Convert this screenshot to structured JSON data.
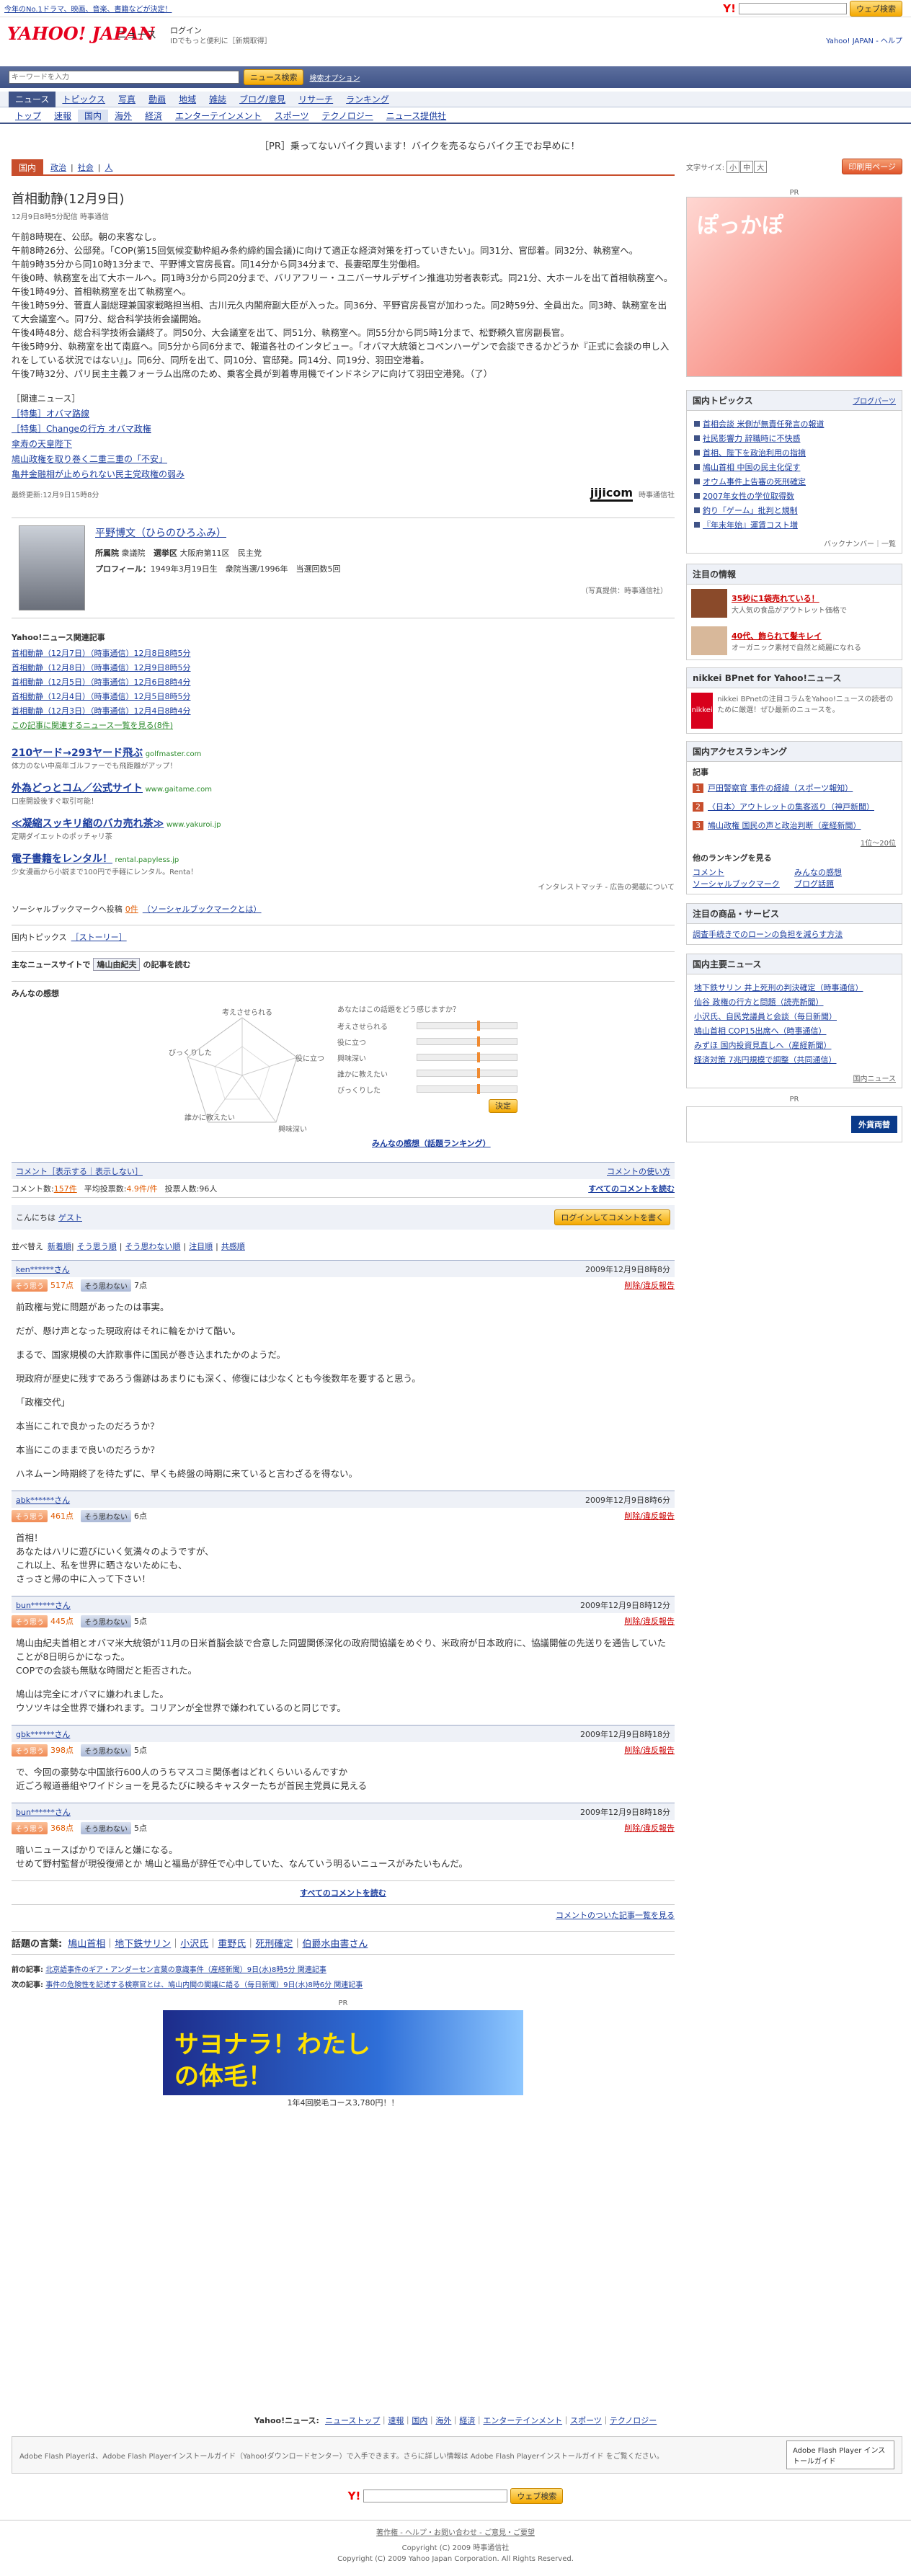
{
  "topbar": {
    "left_text": "今年のNo.1ドラマ、映画、音楽、書籍などが決定！",
    "right_search_button": "ウェブ検索"
  },
  "header": {
    "logo": "YAHOO! JAPAN",
    "section": "ニュース",
    "login": "ログイン",
    "login_note": "IDでもっと便利に［新規取得］",
    "right_links": "Yahoo! JAPAN - ヘルプ"
  },
  "search": {
    "placeholder": "キーワードを入力",
    "button": "ニュース検索",
    "option": "検索オプション"
  },
  "nav1": [
    "ニュース",
    "トピックス",
    "写真",
    "動画",
    "地域",
    "雑誌",
    "ブログ/意見",
    "リサーチ",
    "ランキング"
  ],
  "nav2": [
    "トップ",
    "速報",
    "国内",
    "海外",
    "経済",
    "エンターテインメント",
    "スポーツ",
    "テクノロジー",
    "ニュース提供社"
  ],
  "pr_banner": "［PR］乗ってないバイク買います！バイクを売るならバイク王でお早めに！",
  "tabs": [
    "国内",
    "政治",
    "社会",
    "人"
  ],
  "fontsize_label": "文字サイズ:",
  "fontsize_buttons": [
    "小",
    "中",
    "大"
  ],
  "print_button": "印刷用ページ",
  "article": {
    "title": "首相動静(12月9日)",
    "meta": "12月9日8時5分配信 時事通信",
    "paragraphs": [
      "午前8時現在、公邸。朝の来客なし。",
      "午前8時26分、公邸発。「COP(第15回気候変動枠組み条約締約国会議)に向けて適正な経済対策を打っていきたい」。同31分、官邸着。同32分、執務室へ。",
      "午前9時35分から同10時13分まで、平野博文官房長官。同14分から同34分まで、長妻昭厚生労働相。",
      "午後0時、執務室を出て大ホールへ。同1時3分から同20分まで、バリアフリー・ユニバーサルデザイン推進功労者表彰式。同21分、大ホールを出て首相執務室へ。",
      "午後1時49分、首相執務室を出て執務室へ。",
      "午後1時59分、菅直人副総理兼国家戦略担当相、古川元久内閣府副大臣が入った。同36分、平野官房長官が加わった。同2時59分、全員出た。同3時、執務室を出て大会議室へ。同7分、総合科学技術会議開始。",
      "午後4時48分、総合科学技術会議終了。同50分、大会議室を出て、同51分、執務室へ。同55分から同5時1分まで、松野頼久官房副長官。",
      "午後5時9分、執務室を出て南庭へ。同5分から同6分まで、報道各社のインタビュー。「オバマ大統領とコペンハーゲンで会談できるかどうか『正式に会談の申し入れをしている状況ではない』」。同6分、同所を出て、同10分、官邸発。同14分、同19分、羽田空港着。",
      "午後7時32分、パリ民主主義フォーラム出席のため、乗客全員が到着専用機でインドネシアに向けて羽田空港発。（了）"
    ],
    "related_title": "［関連ニュース］",
    "related": [
      "［特集］オバマ路線",
      "［特集］Changeの行方 オバマ政権",
      "傘寿の天皇陛下",
      "鳩山政権を取り巻く二重三重の「不安」",
      "亀井金融相が止められない民主党政権の弱み"
    ],
    "updated": "最終更新:12月9日15時8分",
    "source_logo": "jijicom",
    "source_name": "時事通信社"
  },
  "profile": {
    "name": "平野博文（ひらのひろふみ）",
    "party_label": "所属院",
    "party": "衆議院",
    "district_label": "選挙区",
    "district": "大阪府第11区",
    "affil": "民主党",
    "profile_label": "プロフィール：",
    "profile_text": "1949年3月19日生　衆院当選/1996年　当選回数5回",
    "photo_credit": "（写真提供：時事通信社）"
  },
  "related_articles": {
    "title": "Yahoo!ニュース関連記事",
    "items": [
      "首相動静（12月7日）（時事通信）12月8日8時5分",
      "首相動静（12月8日）（時事通信）12月9日8時5分",
      "首相動静（12月5日）（時事通信）12月6日8時4分",
      "首相動静（12月4日）（時事通信）12月5日8時5分",
      "首相動静（12月3日）（時事通信）12月4日8時4分"
    ],
    "more": "この記事に関連するニュース一覧を見る(8件)"
  },
  "ads": [
    {
      "title": "210ヤード→293ヤード飛ぶ",
      "url": "golfmaster.com",
      "desc": "体力のない中高年ゴルファーでも飛距離がアップ！"
    },
    {
      "title": "外為どっとコム／公式サイト",
      "url": "www.gaitame.com",
      "desc": "口座開設後すぐ取引可能！"
    },
    {
      "title": "≪凝縮スッキリ縮のバカ売れ茶≫",
      "url": "www.yakuroi.jp",
      "desc": "定期ダイエットのポッチャリ茶"
    },
    {
      "title": "電子書籍をレンタル！",
      "url": "rental.papyless.jp",
      "desc": "少女漫画から小説まで100円で手軽にレンタル。Renta！"
    }
  ],
  "ads_footer": "インタレストマッチ - 広告の掲載について",
  "social": {
    "label": "ソーシャルブックマークへ投稿",
    "count": "0件",
    "link": "（ソーシャルブックマークとは）"
  },
  "topics": {
    "label": "国内トピックス",
    "link": "［ストーリー］"
  },
  "yahoo_main": {
    "label": "主なニュースサイトで",
    "keyword": "鳩山由紀夫",
    "suffix": "の記事を読む"
  },
  "minna": {
    "title": "みんなの感想",
    "question": "あなたはこの話題をどう感じますか？",
    "axes": [
      "考えさせられる",
      "役に立つ",
      "興味深い",
      "誰かに教えたい",
      "びっくりした"
    ],
    "button": "決定",
    "ranking_link": "みんなの感想（話題ランキング）"
  },
  "comments": {
    "header_show": "コメント［表示する｜表示しない］",
    "how_link": "コメントの使い方",
    "count_label": "コメント数:",
    "count": "157件",
    "avg_label": "平均投票数:",
    "avg": "4.9件/件",
    "votes_label": "投票人数:",
    "votes": "96人",
    "read_all": "すべてのコメントを読む",
    "hello": "こんにちは",
    "guest": "ゲスト",
    "login_button": "ログインしてコメントを書く",
    "sort_label": "並べ替え",
    "sort_options": [
      "新着順",
      "そう思う順",
      "そう思わない順",
      "注目順",
      "共感順"
    ],
    "items": [
      {
        "user": "ken******さん",
        "date": "2009年12月9日8時8分",
        "agree": "517点",
        "disagree": "7点",
        "report": "削除/違反報告",
        "body": [
          "前政権与党に問題があったのは事実。",
          "だが、懸け声となった現政府はそれに輪をかけて酷い。",
          "まるで、国家規模の大詐欺事件に国民が巻き込まれたかのようだ。",
          "現政府が歴史に残すであろう傷跡はあまりにも深く、修復には少なくとも今後数年を要すると思う。",
          "「政権交代」",
          "本当にこれで良かったのだろうか？",
          "本当にこのままで良いのだろうか？",
          "ハネムーン時期終了を待たずに、早くも終盤の時期に来ていると言わざるを得ない。"
        ]
      },
      {
        "user": "abk******さん",
        "date": "2009年12月9日8時6分",
        "agree": "461点",
        "disagree": "6点",
        "report": "削除/違反報告",
        "body": [
          "首相！\nあなたはハリに遊びにいく気満々のようですが、\nこれ以上、私を世界に晒さないためにも、\nさっさと帰の中に入って下さい！"
        ]
      },
      {
        "user": "bun******さん",
        "date": "2009年12月9日8時12分",
        "agree": "445点",
        "disagree": "5点",
        "report": "削除/違反報告",
        "body": [
          "鳩山由紀夫首相とオバマ米大統領が11月の日米首脳会談で合意した同盟関係深化の政府間協議をめぐり、米政府が日本政府に、協議開催の先送りを通告していたことが8日明らかになった。\nCOPでの会談も無駄な時間だと拒否された。",
          "鳩山は完全にオバマに嫌われました。\nウソツキは全世界で嫌われます。コリアンが全世界で嫌われているのと同じです。"
        ]
      },
      {
        "user": "gbk******さん",
        "date": "2009年12月9日8時18分",
        "agree": "398点",
        "disagree": "5点",
        "report": "削除/違反報告",
        "body": [
          "で、今回の豪勢な中国旅行600人のうちマスコミ関係者はどれくらいいるんですか\n近ごろ報道番組やワイドショーを見るたびに映るキャスターたちが首民主党員に見える"
        ]
      },
      {
        "user": "bun******さん",
        "date": "2009年12月9日8時18分",
        "agree": "368点",
        "disagree": "5点",
        "report": "削除/違反報告",
        "body": [
          "暗いニュースばかりでほんと嫌になる。\nせめて野村監督が現役復帰とか 鳩山と福島が辞任で心中していた、なんていう明るいニュースがみたいもんだ。"
        ]
      }
    ],
    "read_all_bottom": "すべてのコメントを読む",
    "back_link": "コメントのついた記事一覧を見る"
  },
  "keywords": {
    "label": "話題の言葉:",
    "items": [
      "鳩山首相",
      "地下鉄サリン",
      "小沢氏",
      "重野氏",
      "死刑確定",
      "伯爵水由書さん"
    ]
  },
  "prevnext": {
    "prev_label": "前の記事:",
    "prev": "北京語事件のギア・アンダーセン言葉の意識事件（産経新聞）9日(水)8時5分 関連記事",
    "next_label": "次の記事:",
    "next": "事件の危険性を記述する検察官とは、鳩山内閣の閣議に語る（毎日新聞）9日(水)8時6分 関連記事"
  },
  "bottom_ad": {
    "pr": "PR",
    "headline": "サヨナラ！わたしの体毛！",
    "caption": "1年4回脱毛コース3,780円！！"
  },
  "footer_nav": {
    "label": "Yahoo!ニュース:",
    "items": [
      "ニューストップ",
      "速報",
      "国内",
      "海外",
      "経済",
      "エンターテインメント",
      "スポーツ",
      "テクノロジー"
    ]
  },
  "flash": {
    "text": "Adobe Flash Playerは、Adobe Flash Playerインストールガイド（Yahoo!ダウンロードセンター）で入手できます。さらに詳しい情報は Adobe Flash Playerインストールガイド をご覧ください。",
    "badge": "Adobe Flash Player インストールガイド"
  },
  "footer": {
    "search_button": "ウェブ検索",
    "links": "著作権 - ヘルプ・お問い合わせ - ご意見・ご要望",
    "line2": "Copyright (C) 2009 時事通信社",
    "line3": "Copyright (C) 2009 Yahoo Japan Corporation. All Rights Reserved."
  },
  "side": {
    "pr": "PR",
    "ad_text": "ぽっかぽ",
    "topics_title": "国内トピックス",
    "topics_link": "ブログパーツ",
    "topics": [
      "首相会談 米側が無責任発言の報道",
      "社民影響力 辞職時に不快感",
      "首相、陛下を政治利用の指摘",
      "鳩山首相 中国の民主化促す",
      "オウム事件上告審の死刑確定",
      "2007年女性の学位取得数",
      "釣り「ゲーム」批判と規制",
      "『年末年始』運賃コスト増"
    ],
    "topics_more": "バックナンバー｜一覧",
    "attn_title": "注目の情報",
    "attn": [
      {
        "title": "35秒に1袋売れている！",
        "desc": "大人気の食品がアウトレット価格で"
      },
      {
        "title": "40代、飾られて髪キレイ",
        "desc": "オーガニック素材で自然と綺麗になれる"
      }
    ],
    "nikkei_title": "nikkei BPnet for Yahoo!ニュース",
    "nikkei_desc": "nikkei BPnetの注目コラムをYahoo!ニュースの読者のために厳選！ぜひ最新のニュースを。",
    "ranking_title": "国内アクセスランキング",
    "ranking_sub": "記事",
    "ranking": [
      "戸田警察官 事件の経緯（スポーツ報知）",
      "〈日本〉アウトレットの集客巡り（神戸新聞）",
      "鳩山政権 国民の声と政治判断（産経新聞）"
    ],
    "ranking_more": "1位〜20位",
    "ranking_other": "他のランキングを見る",
    "ranking_links": [
      "コメント",
      "みんなの感想",
      "ソーシャルブックマーク",
      "ブログ話題"
    ],
    "shop_title": "注目の商品・サービス",
    "shop_link": "調査手続きでのローンの負担を減らす方法",
    "news_title": "国内主要ニュース",
    "news": [
      "地下鉄サリン 井上死刑の判決確定（時事通信）",
      "仙谷 政権の行方と問題（読売新聞）",
      "小沢氏、自民党議員と会談（毎日新聞）",
      "鳩山首相 COP15出席へ（時事通信）",
      "みずほ 国内投資見直しへ（産経新聞）",
      "経済対策 7兆円規模で調整（共同通信）"
    ],
    "news_more": "国内ニュース",
    "bottom_pr": "PR",
    "side_banner": "外貨両替"
  }
}
